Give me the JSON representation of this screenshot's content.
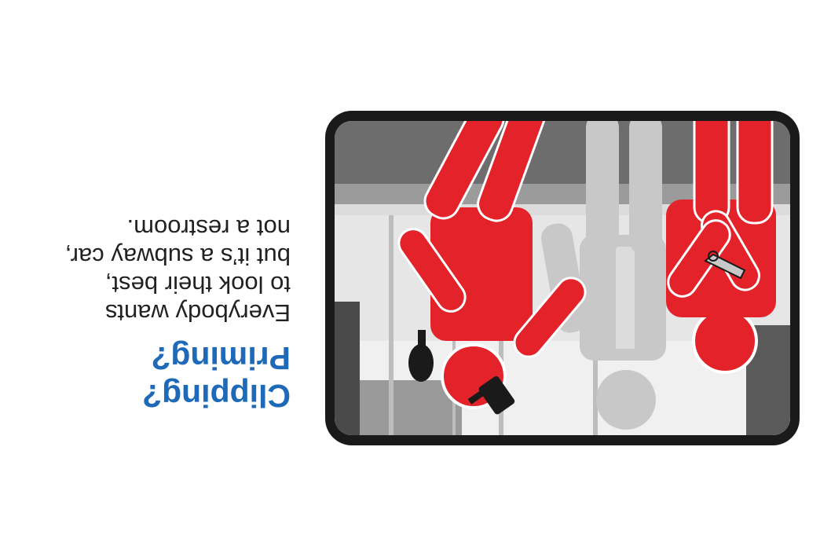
{
  "headline": {
    "line1": "Clipping?",
    "line2": "Priming?"
  },
  "body": {
    "line1": "Everybody wants",
    "line2": "to look their best,",
    "line3": "but it’s a subway car,",
    "line4": "not a restroom."
  },
  "image": {
    "orientation": "rotated-180",
    "subject": "subway-car-grooming-illustration",
    "icons": [
      "nail-clipper-icon",
      "hair-brush-icon",
      "hand-mirror-icon",
      "person-figure-icon"
    ]
  },
  "colors": {
    "headline": "#1e6ab9",
    "text": "#222222",
    "frame": "#1a1a1a",
    "accent_red": "#e32229",
    "neutral_gray": "#c8c8c8"
  }
}
